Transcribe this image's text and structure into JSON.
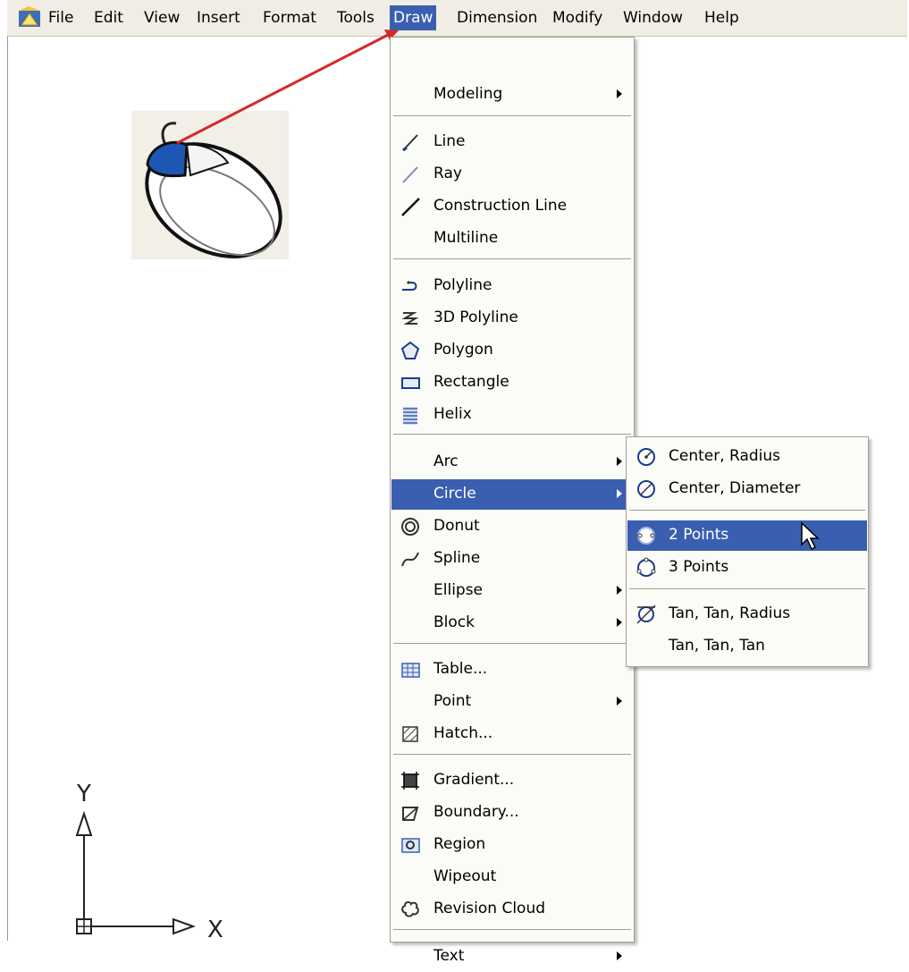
{
  "menubar": {
    "items": [
      "File",
      "Edit",
      "View",
      "Insert",
      "Format",
      "Tools",
      "Draw",
      "Dimension",
      "Modify",
      "Window",
      "Help"
    ],
    "active": "Draw"
  },
  "draw_menu": {
    "items": [
      {
        "label": "Modeling",
        "icon": "",
        "submenu": true
      },
      {
        "label": "Line",
        "icon": "line-icon"
      },
      {
        "label": "Ray",
        "icon": "ray-icon"
      },
      {
        "label": "Construction Line",
        "icon": "construction-line-icon"
      },
      {
        "label": "Multiline",
        "icon": ""
      },
      {
        "label": "Polyline",
        "icon": "polyline-icon"
      },
      {
        "label": "3D Polyline",
        "icon": "3d-polyline-icon"
      },
      {
        "label": "Polygon",
        "icon": "polygon-icon"
      },
      {
        "label": "Rectangle",
        "icon": "rectangle-icon"
      },
      {
        "label": "Helix",
        "icon": "helix-icon"
      },
      {
        "label": "Arc",
        "icon": "",
        "submenu": true
      },
      {
        "label": "Circle",
        "icon": "",
        "submenu": true,
        "highlighted": true
      },
      {
        "label": "Donut",
        "icon": "donut-icon"
      },
      {
        "label": "Spline",
        "icon": "spline-icon"
      },
      {
        "label": "Ellipse",
        "icon": "",
        "submenu": true
      },
      {
        "label": "Block",
        "icon": "",
        "submenu": true
      },
      {
        "label": "Table...",
        "icon": "table-icon"
      },
      {
        "label": "Point",
        "icon": "",
        "submenu": true
      },
      {
        "label": "Hatch...",
        "icon": "hatch-icon"
      },
      {
        "label": "Gradient...",
        "icon": "gradient-icon"
      },
      {
        "label": "Boundary...",
        "icon": "boundary-icon"
      },
      {
        "label": "Region",
        "icon": "region-icon"
      },
      {
        "label": "Wipeout",
        "icon": ""
      },
      {
        "label": "Revision Cloud",
        "icon": "revision-cloud-icon"
      },
      {
        "label": "Text",
        "icon": "",
        "submenu": true
      }
    ]
  },
  "circle_submenu": {
    "items": [
      {
        "label": "Center, Radius",
        "icon": "circle-center-radius-icon"
      },
      {
        "label": "Center, Diameter",
        "icon": "circle-center-diameter-icon"
      },
      {
        "label": "2 Points",
        "icon": "circle-2-points-icon",
        "highlighted": true
      },
      {
        "label": "3 Points",
        "icon": "circle-3-points-icon"
      },
      {
        "label": "Tan, Tan, Radius",
        "icon": "circle-tan-tan-radius-icon"
      },
      {
        "label": "Tan, Tan, Tan",
        "icon": ""
      }
    ]
  },
  "ucs": {
    "y_label": "Y",
    "x_label": "X"
  },
  "colors": {
    "highlight": "#3a5fb0",
    "menu_bg": "#fbfbf8",
    "menubar_bg": "#f0eee4",
    "annotation_arrow": "#d42a2a"
  }
}
